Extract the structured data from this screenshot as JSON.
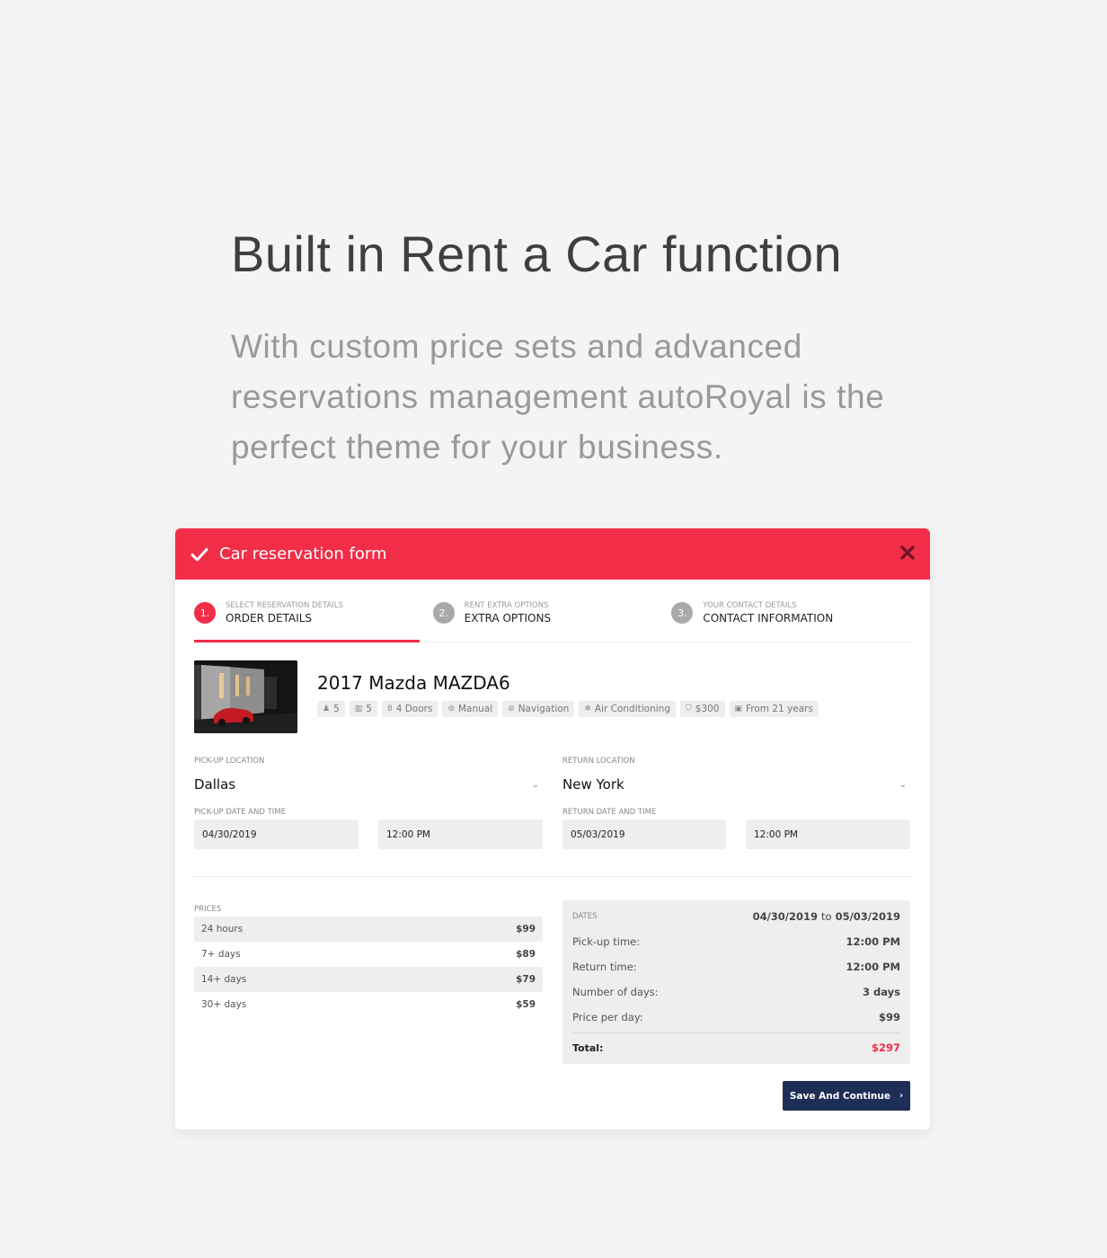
{
  "hero": {
    "title": "Built in Rent a Car function",
    "subtitle": "With custom price sets and advanced reservations management autoRoyal is the perfect theme for your business."
  },
  "form": {
    "title": "Car reservation form",
    "header_icon": "check-icon",
    "close_icon": "close-icon",
    "colors": {
      "accent": "#f12d48",
      "button": "#1e2e57"
    },
    "steps": [
      {
        "num": "1.",
        "small": "Select reservation details",
        "big": "Order details",
        "active": true
      },
      {
        "num": "2.",
        "small": "Rent extra options",
        "big": "Extra options",
        "active": false
      },
      {
        "num": "3.",
        "small": "Your contact details",
        "big": "Contact information",
        "active": false
      }
    ],
    "car": {
      "title": "2017 Mazda MAZDA6",
      "features": [
        {
          "icon": "user-icon",
          "glyph": "♟",
          "label": "5"
        },
        {
          "icon": "luggage-icon",
          "glyph": "▥",
          "label": "5"
        },
        {
          "icon": "door-icon",
          "glyph": "8",
          "label": "4 Doors"
        },
        {
          "icon": "transmission-icon",
          "glyph": "⊜",
          "label": "Manual"
        },
        {
          "icon": "navigation-icon",
          "glyph": "⊘",
          "label": "Navigation"
        },
        {
          "icon": "snowflake-icon",
          "glyph": "❄",
          "label": "Air Conditioning"
        },
        {
          "icon": "shield-icon",
          "glyph": "⛉",
          "label": "$300"
        },
        {
          "icon": "id-card-icon",
          "glyph": "▣",
          "label": "From 21 years"
        }
      ]
    },
    "pickup": {
      "location_label": "Pick-up location",
      "location": "Dallas",
      "datetime_label": "Pick-up date and time",
      "date": "04/30/2019",
      "time": "12:00 PM"
    },
    "return": {
      "location_label": "Return location",
      "location": "New York",
      "datetime_label": "Return date and time",
      "date": "05/03/2019",
      "time": "12:00 PM"
    },
    "prices": {
      "label": "Prices",
      "rows": [
        {
          "period": "24 hours",
          "price": "$99"
        },
        {
          "period": "7+ days",
          "price": "$89"
        },
        {
          "period": "14+ days",
          "price": "$79"
        },
        {
          "period": "30+ days",
          "price": "$59"
        }
      ]
    },
    "summary": {
      "dates_label": "Dates",
      "date_from": "04/30/2019",
      "date_to_word": "to",
      "date_to": "05/03/2019",
      "rows": [
        {
          "label": "Pick-up time:",
          "value": "12:00 PM"
        },
        {
          "label": "Return time:",
          "value": "12:00 PM"
        },
        {
          "label": "Number of days:",
          "value": "3 days"
        },
        {
          "label": "Price per day:",
          "value": "$99"
        }
      ],
      "total_label": "Total:",
      "total_value": "$297"
    },
    "save_button": "Save And Continue"
  }
}
